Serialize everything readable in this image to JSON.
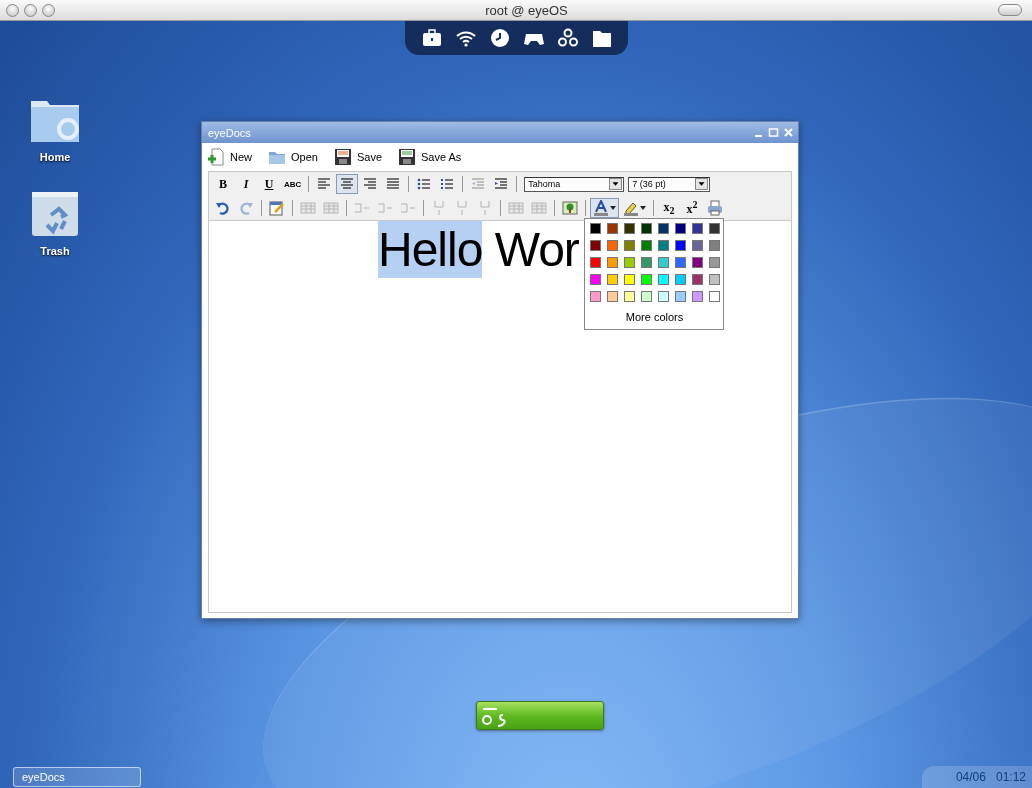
{
  "screen": {
    "title": "root @ eyeOS"
  },
  "dock": {
    "items": [
      {
        "kind": "briefcase"
      },
      {
        "kind": "wifi"
      },
      {
        "kind": "clock"
      },
      {
        "kind": "gamepad"
      },
      {
        "kind": "circles"
      },
      {
        "kind": "folder"
      }
    ]
  },
  "desktop_icons": [
    {
      "label": "Home",
      "kind": "home"
    },
    {
      "label": "Trash",
      "kind": "trash"
    }
  ],
  "window": {
    "title": "eyeDocs",
    "menu": [
      {
        "label": "New",
        "kind": "new"
      },
      {
        "label": "Open",
        "kind": "open"
      },
      {
        "label": "Save",
        "kind": "save"
      },
      {
        "label": "Save As",
        "kind": "saveas"
      }
    ],
    "toolbar_rows": [
      [
        {
          "kind": "text",
          "label": "B"
        },
        {
          "kind": "text",
          "label": "I"
        },
        {
          "kind": "text",
          "label": "U"
        },
        {
          "kind": "text",
          "label": "ABC"
        },
        {
          "kind": "separator"
        },
        {
          "kind": "icon",
          "selected": false,
          "disabled": false
        },
        {
          "kind": "icon",
          "selected": true,
          "disabled": false
        },
        {
          "kind": "icon",
          "selected": false,
          "disabled": false
        },
        {
          "kind": "icon",
          "selected": false,
          "disabled": false
        },
        {
          "kind": "separator"
        },
        {
          "kind": "icon",
          "selected": false,
          "disabled": false
        },
        {
          "kind": "icon",
          "selected": false,
          "disabled": false
        },
        {
          "kind": "separator"
        },
        {
          "kind": "icon",
          "selected": false,
          "disabled": true
        },
        {
          "kind": "icon",
          "selected": false,
          "disabled": false
        },
        {
          "kind": "separator"
        },
        {
          "kind": "select",
          "value": "Tahoma"
        },
        {
          "kind": "select",
          "value": "7 (36 pt)"
        }
      ],
      [
        {
          "kind": "icon",
          "selected": false,
          "disabled": false
        },
        {
          "kind": "icon",
          "selected": false,
          "disabled": true
        },
        {
          "kind": "separator"
        },
        {
          "kind": "icon",
          "selected": false,
          "disabled": false
        },
        {
          "kind": "separator"
        },
        {
          "kind": "icon",
          "selected": false,
          "disabled": true
        },
        {
          "kind": "icon",
          "selected": false,
          "disabled": true
        },
        {
          "kind": "separator"
        },
        {
          "kind": "icon",
          "selected": false,
          "disabled": true
        },
        {
          "kind": "icon",
          "selected": false,
          "disabled": true
        },
        {
          "kind": "icon",
          "selected": false,
          "disabled": true
        },
        {
          "kind": "separator"
        },
        {
          "kind": "icon",
          "selected": false,
          "disabled": true
        },
        {
          "kind": "icon",
          "selected": false,
          "disabled": true
        },
        {
          "kind": "icon",
          "selected": false,
          "disabled": true
        },
        {
          "kind": "separator"
        },
        {
          "kind": "icon",
          "selected": false,
          "disabled": true
        },
        {
          "kind": "icon",
          "selected": false,
          "disabled": true
        },
        {
          "kind": "separator"
        },
        {
          "kind": "icon",
          "selected": false,
          "disabled": false
        },
        {
          "kind": "separator"
        },
        {
          "kind": "dropdown",
          "selected": true
        },
        {
          "kind": "dropdown",
          "selected": false
        },
        {
          "kind": "separator"
        },
        {
          "kind": "text",
          "label": "x$_{2}$"
        },
        {
          "kind": "text",
          "label": "x$^{2}$"
        },
        {
          "kind": "icon",
          "selected": false,
          "disabled": false
        }
      ]
    ],
    "document": [
      {
        "text": "Hello",
        "selected": true
      },
      {
        "text": " Wor",
        "selected": false
      }
    ],
    "color_palette": {
      "colors": [
        {
          "color": "#000000"
        },
        {
          "color": "#993300"
        },
        {
          "color": "#333300"
        },
        {
          "color": "#003300"
        },
        {
          "color": "#003366"
        },
        {
          "color": "#000080"
        },
        {
          "color": "#333399"
        },
        {
          "color": "#333333"
        },
        {
          "color": "#800000"
        },
        {
          "color": "#ff6600"
        },
        {
          "color": "#808000"
        },
        {
          "color": "#008000"
        },
        {
          "color": "#008080"
        },
        {
          "color": "#0000ff"
        },
        {
          "color": "#666699"
        },
        {
          "color": "#808080"
        },
        {
          "color": "#ff0000"
        },
        {
          "color": "#ff9900"
        },
        {
          "color": "#99cc00"
        },
        {
          "color": "#339966"
        },
        {
          "color": "#33cccc"
        },
        {
          "color": "#3366ff"
        },
        {
          "color": "#800080"
        },
        {
          "color": "#999999"
        },
        {
          "color": "#ff00ff"
        },
        {
          "color": "#ffcc00"
        },
        {
          "color": "#ffff00"
        },
        {
          "color": "#00ff00"
        },
        {
          "color": "#00ffff"
        },
        {
          "color": "#00ccff"
        },
        {
          "color": "#993366"
        },
        {
          "color": "#c0c0c0"
        },
        {
          "color": "#ff99cc"
        },
        {
          "color": "#ffcc99"
        },
        {
          "color": "#ffff99"
        },
        {
          "color": "#ccffcc"
        },
        {
          "color": "#ccffff"
        },
        {
          "color": "#99ccff"
        },
        {
          "color": "#cc99ff"
        },
        {
          "color": "#ffffff"
        }
      ],
      "more_label": "More colors"
    }
  },
  "taskbar": {
    "items": [
      {
        "label": "eyeDocs"
      }
    ],
    "date": "04/06",
    "time": "01:12"
  }
}
